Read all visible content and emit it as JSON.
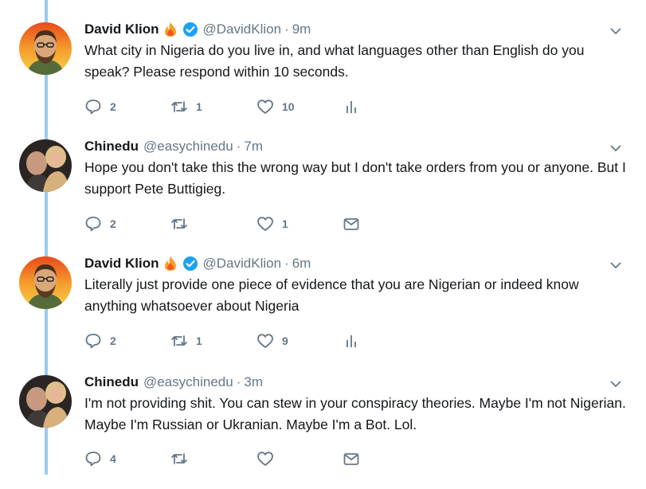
{
  "tweets": [
    {
      "name": "David Klion",
      "handle": "@DavidKlion",
      "time": "9m",
      "verified": true,
      "text": "What city in Nigeria do you live in, and what languages other than English do you speak? Please respond within 10 seconds.",
      "replies": "2",
      "retweets": "1",
      "likes": "10",
      "last_icon": "analytics-icon"
    },
    {
      "name": "Chinedu",
      "handle": "@easychinedu",
      "time": "7m",
      "verified": false,
      "text": "Hope you don't take this the wrong way but I don't take orders from you or anyone. But I support Pete Buttigieg.",
      "replies": "2",
      "retweets": "",
      "likes": "1",
      "last_icon": "direct-message-icon"
    },
    {
      "name": "David Klion",
      "handle": "@DavidKlion",
      "time": "6m",
      "verified": true,
      "text": "Literally just provide one piece of evidence that you are Nigerian or indeed know anything whatsoever about Nigeria",
      "replies": "2",
      "retweets": "1",
      "likes": "9",
      "last_icon": "analytics-icon"
    },
    {
      "name": "Chinedu",
      "handle": "@easychinedu",
      "time": "3m",
      "verified": false,
      "text": "I'm not providing shit. You can stew in your conspiracy theories. Maybe I'm not Nigerian. Maybe I'm Russian or Ukranian. Maybe I'm a Bot. Lol.",
      "replies": "4",
      "retweets": "",
      "likes": "",
      "last_icon": "direct-message-icon"
    }
  ],
  "separator": "·",
  "colors": {
    "thread_line": "#9dc9ec",
    "secondary_text": "#657786",
    "verified_blue": "#1da1f2",
    "fire": "#f7a12b"
  }
}
